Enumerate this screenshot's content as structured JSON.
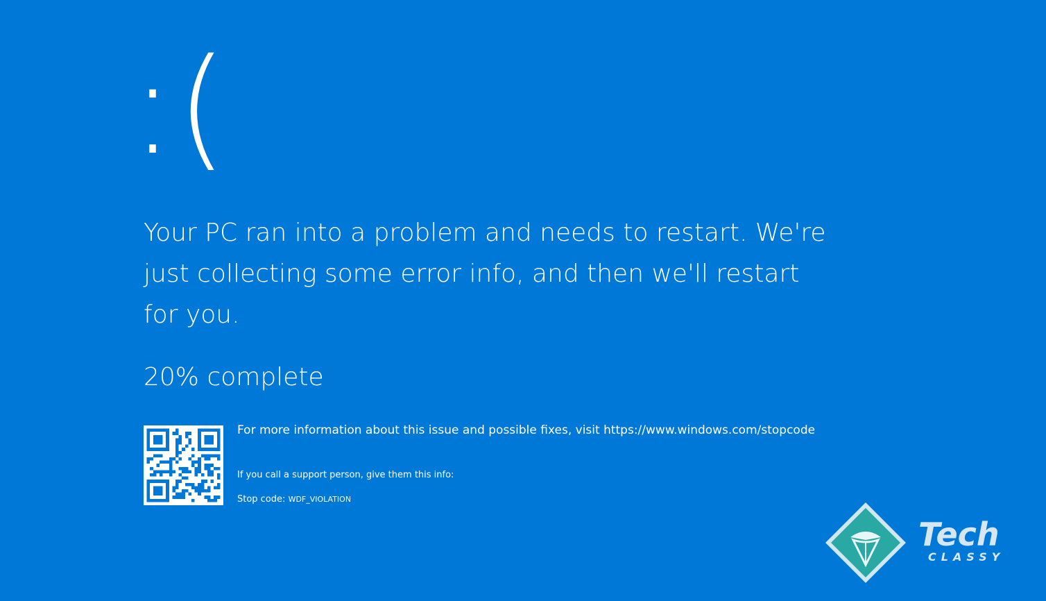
{
  "screen": {
    "background_color": "#0078d7",
    "frown_face": ":(",
    "message": "Your PC ran into a problem and needs to restart. We're just collecting some error info, and then we'll restart for you.",
    "progress": {
      "percent": 20,
      "text": "20% complete"
    },
    "qr_code": {
      "icon": "qr-code-icon"
    },
    "more_info": "For more information about this issue and possible fixes, visit https://www.windows.com/stopcode",
    "support_text": "If you call a support person, give them this info:",
    "stop_code_label": "Stop code:",
    "stop_code": "WDF_VIOLATION"
  },
  "watermark": {
    "line1": "Tech",
    "line2": "CLASSY",
    "emblem_icon": "diamond-emblem-icon",
    "colors": {
      "emblem_fill": "#2aa8a3",
      "emblem_border": "#cfe8f2",
      "text": "#d6e6f2"
    }
  }
}
